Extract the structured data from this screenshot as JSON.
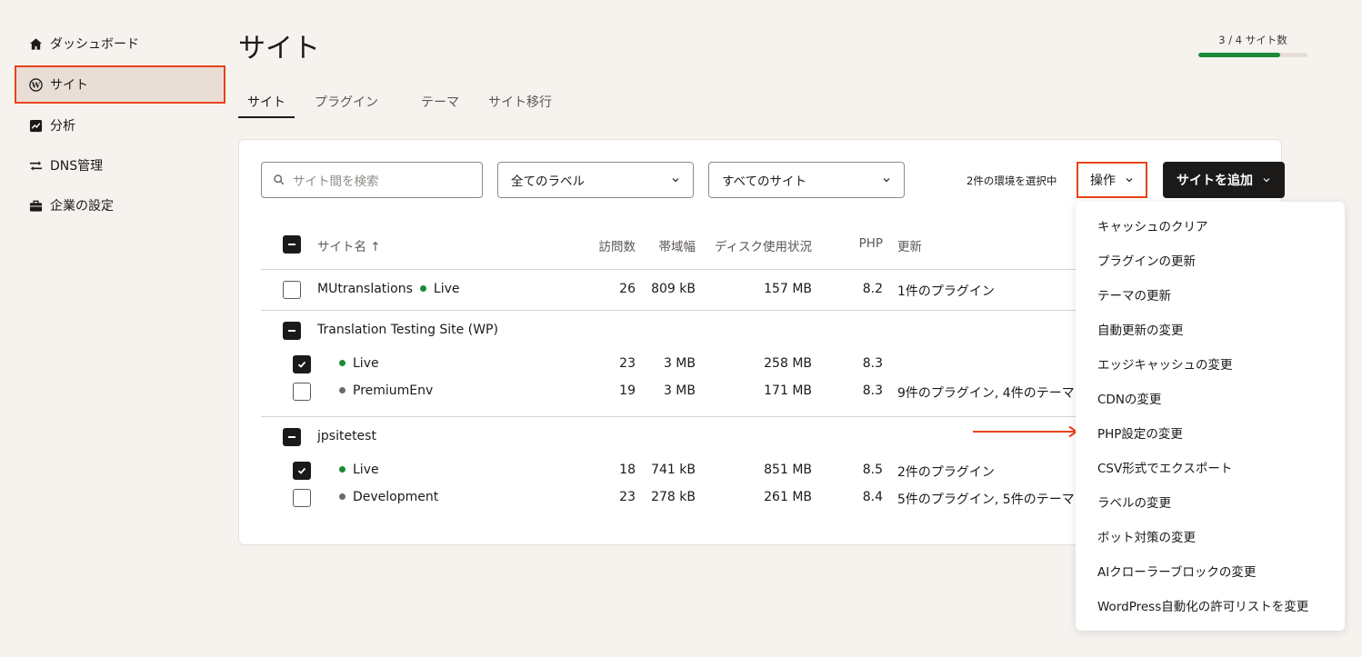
{
  "sidebar": {
    "items": [
      {
        "label": "ダッシュボード",
        "icon": "home-icon"
      },
      {
        "label": "サイト",
        "icon": "wordpress-icon",
        "active": true
      },
      {
        "label": "分析",
        "icon": "analytics-icon"
      },
      {
        "label": "DNS管理",
        "icon": "dns-icon"
      },
      {
        "label": "企業の設定",
        "icon": "briefcase-icon"
      }
    ]
  },
  "header": {
    "title": "サイト",
    "quota_text": "3 / 4 サイト数",
    "quota_fraction": 0.75
  },
  "tabs": [
    "サイト",
    "プラグイン",
    "テーマ",
    "サイト移行"
  ],
  "toolbar": {
    "search_placeholder": "サイト間を検索",
    "label_filter": "全てのラベル",
    "site_filter": "すべてのサイト",
    "selected_count": "2件の環境を選択中",
    "ops_label": "操作",
    "add_site_label": "サイトを追加"
  },
  "table": {
    "headers": {
      "name": "サイト名 ↑",
      "visits": "訪問数",
      "bandwidth": "帯域幅",
      "disk": "ディスク使用状況",
      "php": "PHP",
      "updates": "更新"
    },
    "rows": [
      {
        "name": "MUtranslations",
        "env": "Live",
        "visits": "26",
        "bandwidth": "809 kB",
        "disk": "157 MB",
        "php": "8.2",
        "updates": "1件のプラグイン"
      },
      {
        "group": "Translation Testing Site (WP)"
      },
      {
        "env": "Live",
        "visits": "23",
        "bandwidth": "3 MB",
        "disk": "258 MB",
        "php": "8.3",
        "updates": ""
      },
      {
        "env": "PremiumEnv",
        "visits": "19",
        "bandwidth": "3 MB",
        "disk": "171 MB",
        "php": "8.3",
        "updates": "9件のプラグイン, 4件のテーマ"
      },
      {
        "group": "jpsitetest"
      },
      {
        "env": "Live",
        "visits": "18",
        "bandwidth": "741 kB",
        "disk": "851 MB",
        "php": "8.5",
        "updates": "2件のプラグイン"
      },
      {
        "env": "Development",
        "visits": "23",
        "bandwidth": "278 kB",
        "disk": "261 MB",
        "php": "8.4",
        "updates": "5件のプラグイン, 5件のテーマ"
      }
    ]
  },
  "menu": {
    "items": [
      "キャッシュのクリア",
      "プラグインの更新",
      "テーマの更新",
      "自動更新の変更",
      "エッジキャッシュの変更",
      "CDNの変更",
      "PHP設定の変更",
      "CSV形式でエクスポート",
      "ラベルの変更",
      "ボット対策の変更",
      "AIクローラーブロックの変更",
      "WordPress自動化の許可リストを変更"
    ]
  },
  "colors": {
    "accent": "#e8431b",
    "live_dot": "#1a8a3a",
    "other_dot": "#6e6a67",
    "primary_button": "#1b1a19"
  }
}
